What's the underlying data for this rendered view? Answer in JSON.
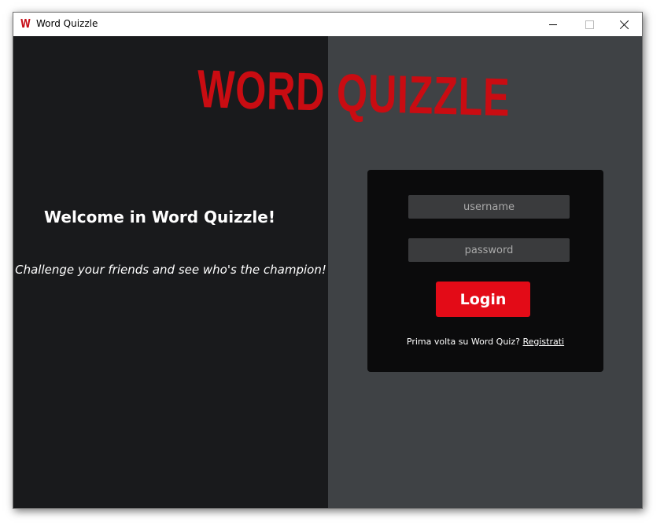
{
  "window": {
    "title": "Word Quizzle",
    "app_icon_letter": "W",
    "controls": {
      "minimize": "minimize-icon",
      "maximize": "maximize-icon",
      "close": "close-icon"
    }
  },
  "brand": {
    "logo_text": "WORD QUIZZLE",
    "logo_color": "#c90c12"
  },
  "intro": {
    "welcome": "Welcome in Word Quizzle!",
    "tagline": "Challenge your friends and see who's the champion!"
  },
  "login_form": {
    "username_placeholder": "username",
    "username_value": "",
    "password_placeholder": "password",
    "password_value": "",
    "login_label": "Login",
    "signup_prompt": "Prima volta su Word Quiz?",
    "signup_link": "Registrati"
  },
  "colors": {
    "left_panel": "#191a1c",
    "right_panel": "#3f4245",
    "card": "#0b0b0c",
    "accent": "#e30b17",
    "input": "#3a3b3d"
  }
}
